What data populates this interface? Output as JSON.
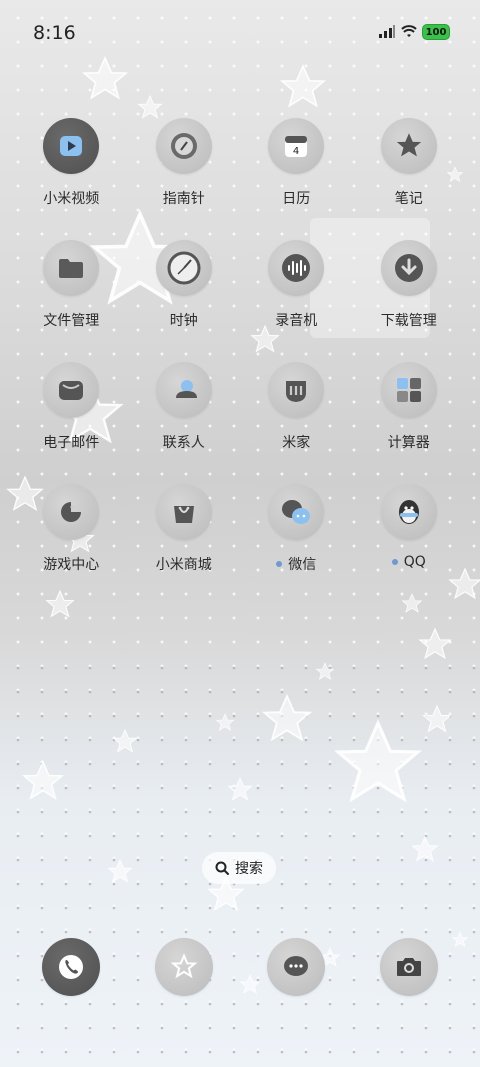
{
  "status_bar": {
    "time": "8:16",
    "battery": "100",
    "icons": [
      "signal-icon",
      "wifi-icon",
      "battery-icon"
    ]
  },
  "apps": [
    {
      "label": "小米视频",
      "icon": "video-play-icon"
    },
    {
      "label": "指南针",
      "icon": "compass-icon"
    },
    {
      "label": "日历",
      "icon": "calendar-icon",
      "day": "4"
    },
    {
      "label": "笔记",
      "icon": "star-note-icon"
    },
    {
      "label": "文件管理",
      "icon": "folder-icon"
    },
    {
      "label": "时钟",
      "icon": "clock-icon"
    },
    {
      "label": "录音机",
      "icon": "waveform-icon"
    },
    {
      "label": "下载管理",
      "icon": "download-icon"
    },
    {
      "label": "电子邮件",
      "icon": "mail-icon"
    },
    {
      "label": "联系人",
      "icon": "contact-icon"
    },
    {
      "label": "米家",
      "icon": "mijia-icon"
    },
    {
      "label": "计算器",
      "icon": "calculator-icon"
    },
    {
      "label": "游戏中心",
      "icon": "game-icon"
    },
    {
      "label": "小米商城",
      "icon": "shopping-bag-icon"
    },
    {
      "label": "微信",
      "icon": "chat-bubbles-icon",
      "notification_dot": true
    },
    {
      "label": "QQ",
      "icon": "penguin-icon",
      "notification_dot": true
    }
  ],
  "search": {
    "label": "搜索",
    "icon": "search-icon"
  },
  "dock": [
    {
      "app": "phone",
      "icon": "phone-icon"
    },
    {
      "app": "favorites",
      "icon": "star-icon"
    },
    {
      "app": "messages",
      "icon": "message-icon"
    },
    {
      "app": "camera",
      "icon": "camera-icon"
    }
  ],
  "colors": {
    "accent_dot": "#6d9bd1",
    "battery": "#38c24a"
  }
}
